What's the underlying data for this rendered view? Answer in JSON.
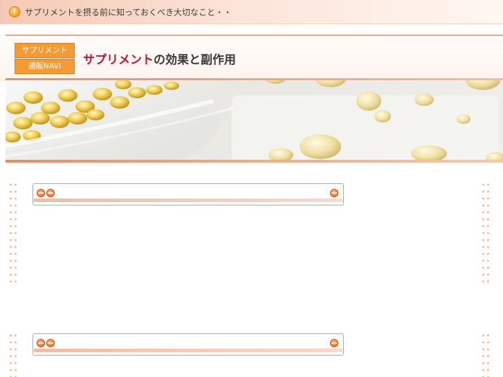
{
  "top_bar": {
    "notice": "サプリメントを摂る前に知っておくべき大切なこと・・",
    "icon": "alert-icon",
    "icon_glyph": "!"
  },
  "header": {
    "badge_line1": "サプリメント",
    "badge_line2": "通販NAVI",
    "title_highlight": "サプリメント",
    "title_rest": "の効果と副作用",
    "accent_color": "#c8102e",
    "badge_color": "#f59b33"
  },
  "hero": {
    "image": "supplement-capsules-photo"
  },
  "panels": [
    {
      "name": "content-panel-1",
      "title": ""
    },
    {
      "name": "content-panel-2",
      "title": ""
    }
  ]
}
